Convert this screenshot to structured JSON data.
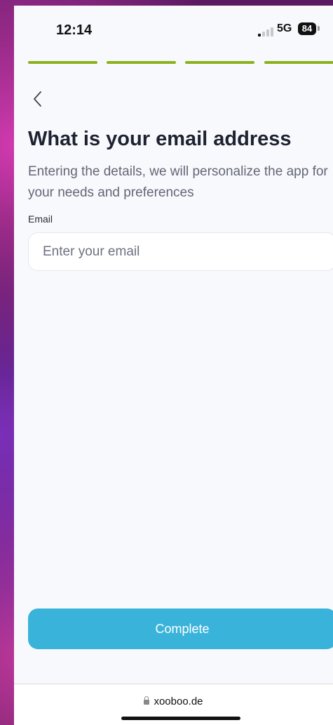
{
  "status_bar": {
    "time": "12:14",
    "network": "5G",
    "battery": "84"
  },
  "progress": {
    "steps_total": 4,
    "steps_completed": 4,
    "color": "#8cb21b"
  },
  "header": {
    "back_icon": "chevron-left-icon",
    "title": "What is your email address",
    "subtitle": "Entering the details, we will personalize the app for your needs and preferences"
  },
  "form": {
    "email_label": "Email",
    "email_placeholder": "Enter your email",
    "email_value": ""
  },
  "actions": {
    "complete_label": "Complete",
    "button_color": "#3ab3da"
  },
  "browser": {
    "url": "xooboo.de"
  }
}
